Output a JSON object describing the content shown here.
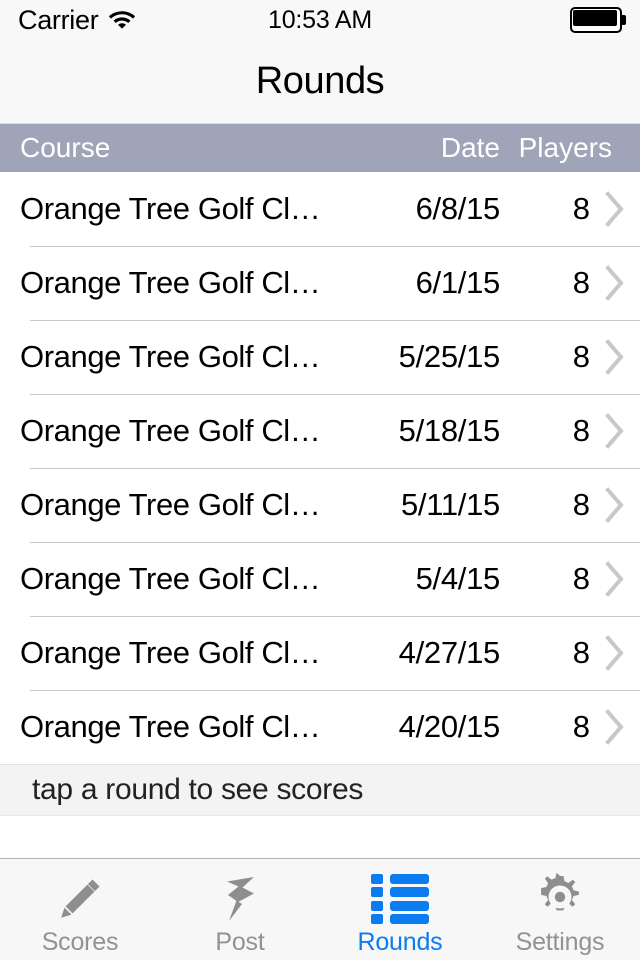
{
  "status_bar": {
    "carrier": "Carrier",
    "wifi_icon": "wifi-icon",
    "time": "10:53 AM",
    "battery_icon": "battery-full-icon"
  },
  "nav": {
    "title": "Rounds"
  },
  "table": {
    "columns": {
      "course": "Course",
      "date": "Date",
      "players": "Players"
    },
    "header_bg": "#a0a4b8",
    "rows": [
      {
        "course": "Orange Tree Golf Cl…",
        "date": "6/8/15",
        "players": "8",
        "chevron": "chevron-right-icon"
      },
      {
        "course": "Orange Tree Golf Cl…",
        "date": "6/1/15",
        "players": "8",
        "chevron": "chevron-right-icon"
      },
      {
        "course": "Orange Tree Golf Cl…",
        "date": "5/25/15",
        "players": "8",
        "chevron": "chevron-right-icon"
      },
      {
        "course": "Orange Tree Golf Cl…",
        "date": "5/18/15",
        "players": "8",
        "chevron": "chevron-right-icon"
      },
      {
        "course": "Orange Tree Golf Cl…",
        "date": "5/11/15",
        "players": "8",
        "chevron": "chevron-right-icon"
      },
      {
        "course": "Orange Tree Golf Cl…",
        "date": "5/4/15",
        "players": "8",
        "chevron": "chevron-right-icon"
      },
      {
        "course": "Orange Tree Golf Cl…",
        "date": "4/27/15",
        "players": "8",
        "chevron": "chevron-right-icon"
      },
      {
        "course": "Orange Tree Golf Cl…",
        "date": "4/20/15",
        "players": "8",
        "chevron": "chevron-right-icon"
      }
    ]
  },
  "footer_note": "tap a round to see scores",
  "tabbar": {
    "active_color": "#0a7cf0",
    "inactive_color": "#929292",
    "tabs": [
      {
        "label": "Scores",
        "icon": "pencil-icon",
        "active": false
      },
      {
        "label": "Post",
        "icon": "pushpin-icon",
        "active": false
      },
      {
        "label": "Rounds",
        "icon": "list-icon",
        "active": true
      },
      {
        "label": "Settings",
        "icon": "gear-icon",
        "active": false
      }
    ]
  }
}
